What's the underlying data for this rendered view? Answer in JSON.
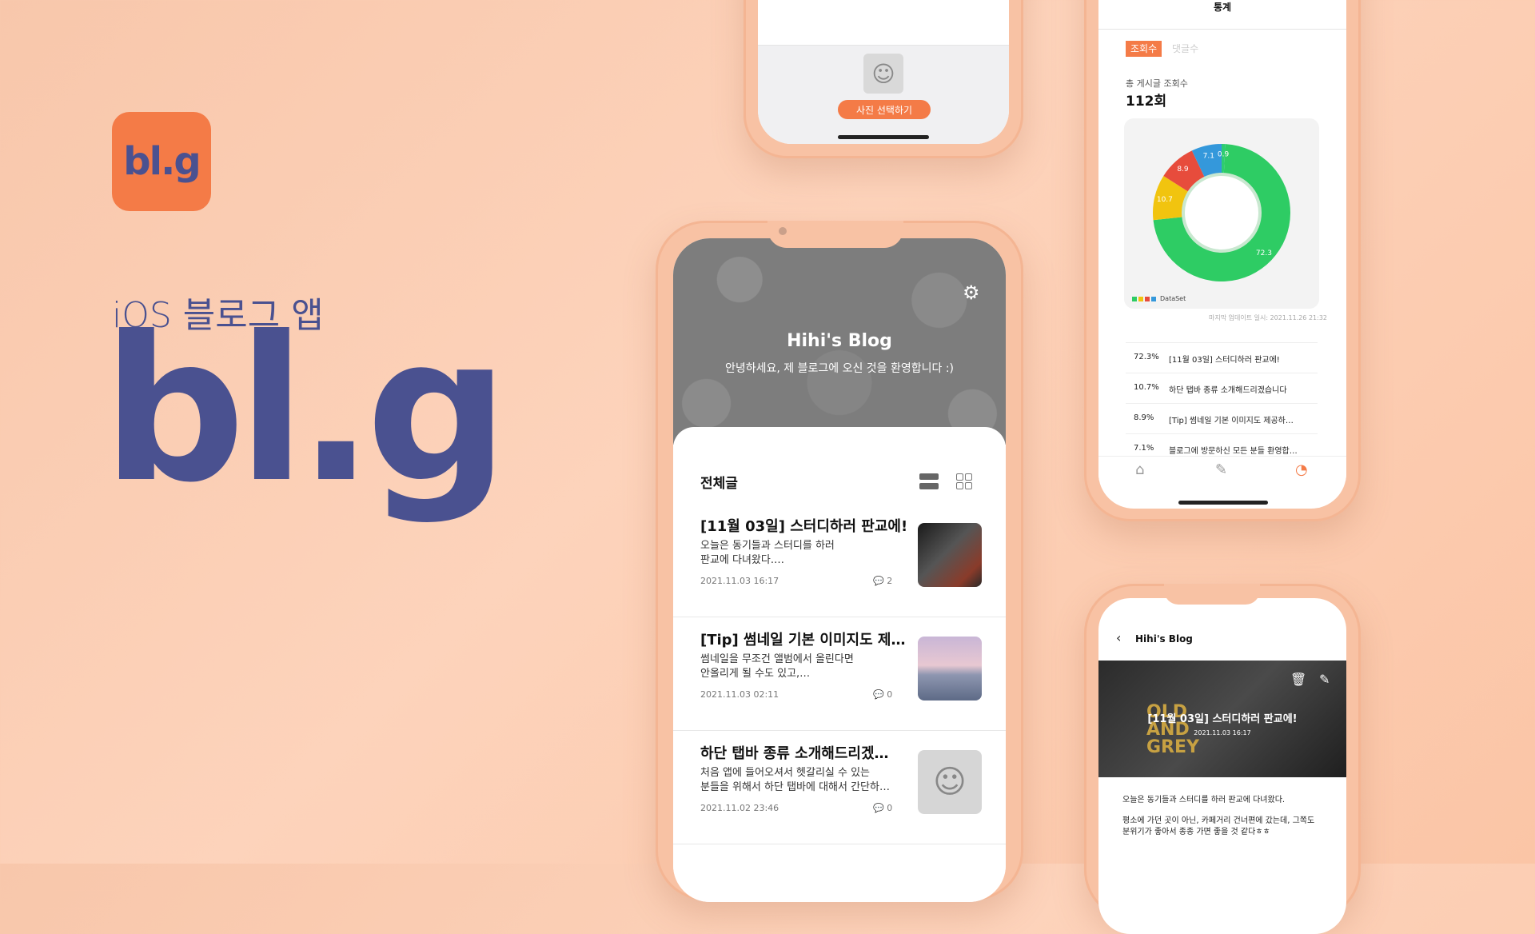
{
  "brand": {
    "icon_text": "bl.g",
    "subtitle": "iOS 블로그 앱",
    "logo": "bl.g",
    "accent": "#f47b47",
    "navy": "#4a5190"
  },
  "photo_screen": {
    "pick_button": "사진 선택하기"
  },
  "main_screen": {
    "blog_title": "Hihi's Blog",
    "greeting": "안녕하세요, 제 블로그에 오신 것을 환영합니다 :)",
    "section_title": "전체글",
    "posts": [
      {
        "title": "[11월 03일] 스터디하러 판교에!",
        "body": "오늘은 동기들과 스터디를 하러\n판교에 다녀왔다.…",
        "date": "2021.11.03 16:17",
        "comments": "2"
      },
      {
        "title": "[Tip] 썸네일 기본 이미지도 제…",
        "body": "썸네일을 무조건 앨범에서 올린다면\n안올리게 될 수도 있고,…",
        "date": "2021.11.03 02:11",
        "comments": "0"
      },
      {
        "title": "하단 탭바 종류 소개해드리겠…",
        "body": "처음 앱에 들어오셔서 헷갈리실 수 있는\n분들을 위해서 하단 탭바에 대해서 간단하…",
        "date": "2021.11.02 23:46",
        "comments": "0"
      }
    ]
  },
  "stats_screen": {
    "title": "통계",
    "tab_views": "조회수",
    "tab_comments": "댓글수",
    "total_label": "총 게시글 조회수",
    "total_value": "112회",
    "legend": "DataSet",
    "last_update": "마지막 업데이트 일시: 2021.11.26 21:32",
    "ranking": [
      {
        "pct": "72.3%",
        "title": "[11월 03일] 스터디하러 판교에!"
      },
      {
        "pct": "10.7%",
        "title": "하단 탭바 종류 소개해드리겠습니다"
      },
      {
        "pct": "8.9%",
        "title": "[Tip] 썸네일 기본 이미지도 제공하…"
      },
      {
        "pct": "7.1%",
        "title": "블로그에 방문하신 모든 분들 환영합…"
      }
    ]
  },
  "chart_data": {
    "type": "pie",
    "variant": "donut",
    "series": [
      {
        "value": 72.3,
        "color": "#2ecc64"
      },
      {
        "value": 10.7,
        "color": "#f1c40f"
      },
      {
        "value": 8.9,
        "color": "#e74c3c"
      },
      {
        "value": 7.1,
        "color": "#3498db"
      },
      {
        "value": 0.9,
        "color": "#2ecc71"
      }
    ],
    "labels": [
      "72.3",
      "10.7",
      "8.9",
      "7.1",
      "0.9"
    ],
    "legend": "DataSet",
    "legend_position": "bottom-left"
  },
  "detail_screen": {
    "nav_title": "Hihi's Blog",
    "hero_sign": "OLD\nAND\nGREY",
    "post_title": "[11월 03일] 스터디하러 판교에!",
    "post_date": "2021.11.03 16:17",
    "paragraph1": "오늘은 동기들과 스터디를 하러 판교에 다녀왔다.",
    "paragraph2": "평소에 가던 곳이 아닌, 카페거리 건너편에 갔는데, 그쪽도\n분위기가 좋아서 종종 가면 좋을 것 같다ㅎㅎ"
  }
}
